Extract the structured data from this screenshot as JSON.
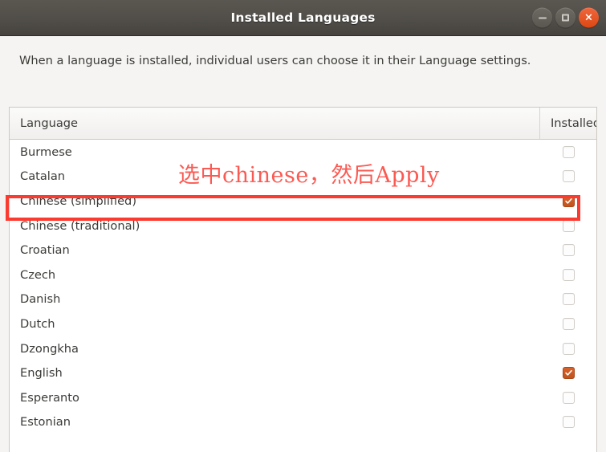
{
  "window": {
    "title": "Installed Languages",
    "controls": [
      {
        "name": "minimize",
        "glyph": "minimize-icon"
      },
      {
        "name": "maximize",
        "glyph": "maximize-icon"
      },
      {
        "name": "close",
        "glyph": "close-icon",
        "label": "×"
      }
    ]
  },
  "description": "When a language is installed, individual users can choose it in their Language settings.",
  "table": {
    "headers": {
      "language": "Language",
      "installed": "Installed"
    },
    "rows": [
      {
        "language": "Burmese",
        "installed": false
      },
      {
        "language": "Catalan",
        "installed": false
      },
      {
        "language": "Chinese (simplified)",
        "installed": true
      },
      {
        "language": "Chinese (traditional)",
        "installed": false
      },
      {
        "language": "Croatian",
        "installed": false
      },
      {
        "language": "Czech",
        "installed": false
      },
      {
        "language": "Danish",
        "installed": false
      },
      {
        "language": "Dutch",
        "installed": false
      },
      {
        "language": "Dzongkha",
        "installed": false
      },
      {
        "language": "English",
        "installed": true
      },
      {
        "language": "Esperanto",
        "installed": false
      },
      {
        "language": "Estonian",
        "installed": false
      }
    ]
  },
  "annotation": {
    "text": "选中chinese，然后Apply",
    "color": "#fb5a53",
    "highlight_color": "#fb3a30",
    "highlight_target": "Chinese (simplified)"
  },
  "colors": {
    "titlebar": "#514e49",
    "close_button": "#dd4814",
    "checkbox_checked": "#c0531b",
    "text": "#3b3b38",
    "background": "#f5f4f2"
  }
}
